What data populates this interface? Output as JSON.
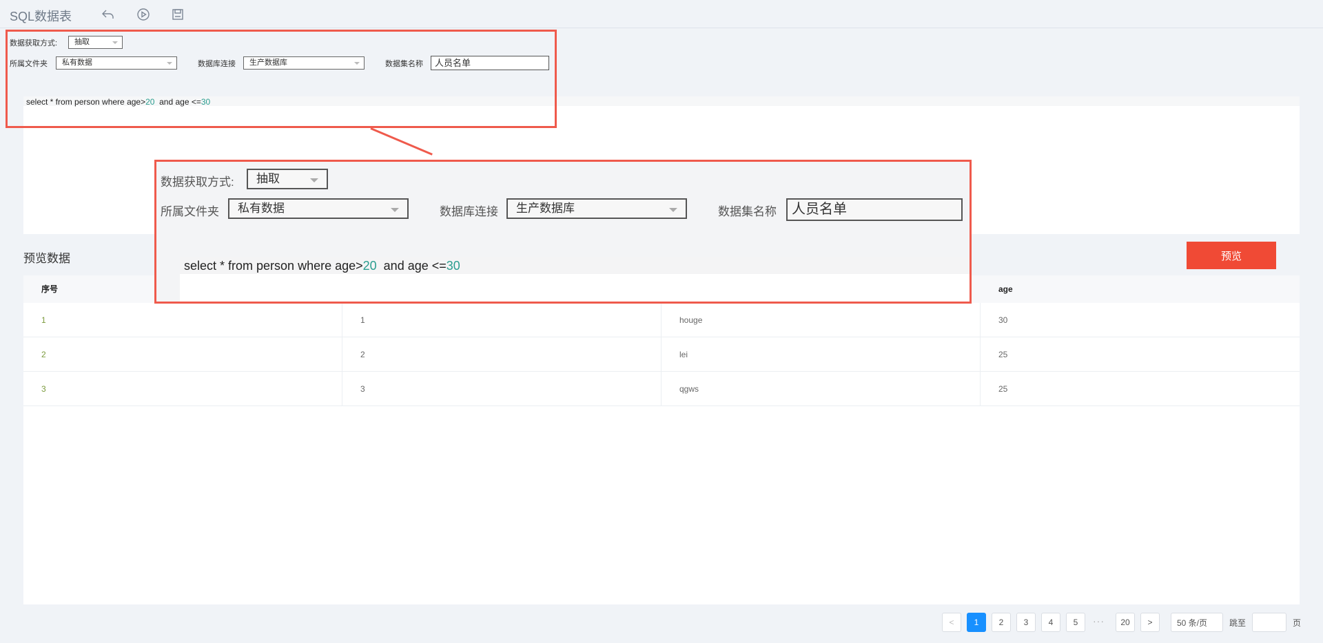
{
  "app": {
    "title": "SQL数据表"
  },
  "toolbar": {
    "icons": [
      "undo-icon",
      "run-icon",
      "save-icon"
    ]
  },
  "form": {
    "fetch_mode_label": "数据获取方式:",
    "fetch_mode_value": "抽取",
    "folder_label": "所属文件夹",
    "folder_value": "私有数据",
    "db_label": "数据库连接",
    "db_value": "生产数据库",
    "dataset_label": "数据集名称",
    "dataset_value": "人员名单"
  },
  "sql": {
    "part1": "select * from person where age>",
    "num1": "20",
    "part2": "  and age <=",
    "num2": "30"
  },
  "preview": {
    "title": "预览数据",
    "button_label": "预览"
  },
  "table": {
    "columns": [
      "序号",
      "",
      "",
      "age"
    ],
    "rows": [
      [
        "1",
        "1",
        "houge",
        "30"
      ],
      [
        "2",
        "2",
        "lei",
        "25"
      ],
      [
        "3",
        "3",
        "qgws",
        "25"
      ]
    ]
  },
  "pagination": {
    "prev": "<",
    "pages": [
      "1",
      "2",
      "3",
      "4",
      "5"
    ],
    "ellipsis": "···",
    "last": "20",
    "next": ">",
    "current": "1",
    "page_size": "50 条/页",
    "jump_label": "跳至",
    "page_suffix": "页"
  },
  "colors": {
    "accent": "#f04a35",
    "annotation": "#ef5a4c",
    "active_page": "#1890ff"
  }
}
